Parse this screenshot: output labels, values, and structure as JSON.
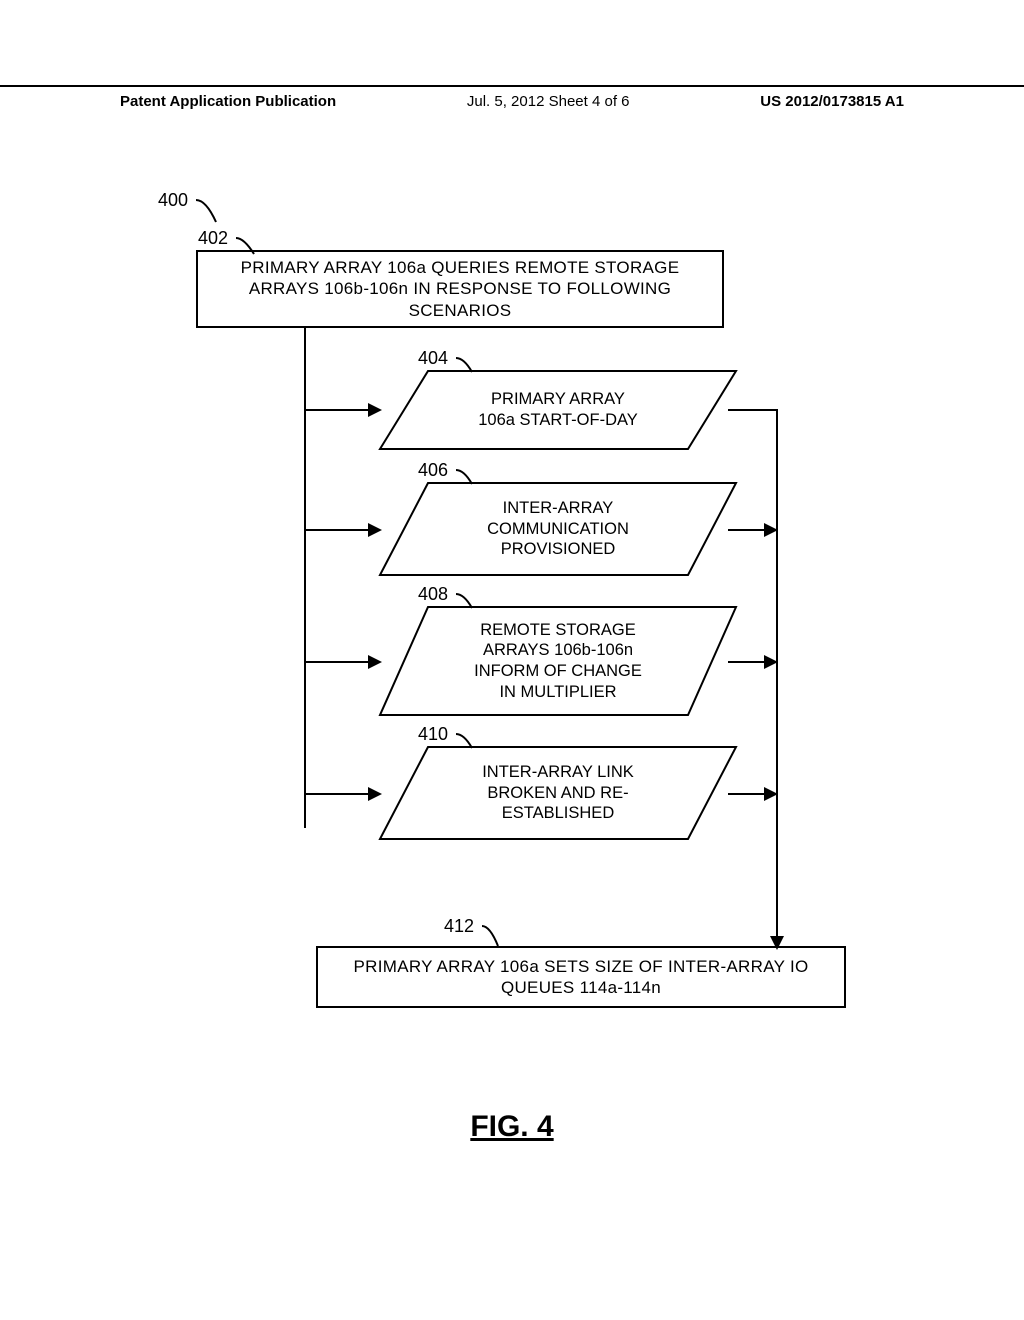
{
  "header": {
    "left": "Patent Application Publication",
    "center": "Jul. 5, 2012   Sheet 4 of 6",
    "right": "US 2012/0173815 A1"
  },
  "refs": {
    "r400": "400",
    "r402": "402",
    "r404": "404",
    "r406": "406",
    "r408": "408",
    "r410": "410",
    "r412": "412"
  },
  "boxes": {
    "b402": "PRIMARY ARRAY 106a QUERIES REMOTE STORAGE ARRAYS 106b-106n IN RESPONSE TO FOLLOWING SCENARIOS",
    "b404": "PRIMARY ARRAY\n106a START-OF-DAY",
    "b406": "INTER-ARRAY\nCOMMUNICATION\nPROVISIONED",
    "b408": "REMOTE STORAGE\nARRAYS 106b-106n\nINFORM OF CHANGE\nIN MULTIPLIER",
    "b410": "INTER-ARRAY LINK\nBROKEN AND RE-\nESTABLISHED",
    "b412": "PRIMARY ARRAY 106a SETS SIZE OF INTER-ARRAY IO QUEUES 114a-114n"
  },
  "figure_caption": "FIG. 4"
}
